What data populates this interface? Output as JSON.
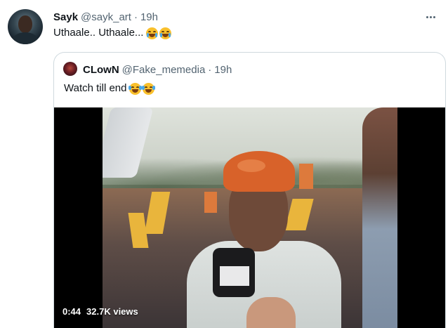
{
  "tweet": {
    "display_name": "Sayk",
    "handle": "@sayk_art",
    "separator": "·",
    "time": "19h",
    "text": "Uthaale.. Uthaale...",
    "emojis": [
      "crying-face",
      "crying-face"
    ]
  },
  "quoted": {
    "display_name": "CLowN",
    "handle": "@Fake_memedia",
    "separator": "·",
    "time": "19h",
    "text": "Watch till end",
    "emojis": [
      "tears-of-joy-face",
      "tears-of-joy-face"
    ],
    "video": {
      "duration": "0:44",
      "views": "32.7K views"
    }
  },
  "icons": {
    "more": "more-horizontal-icon"
  },
  "colors": {
    "text_primary": "#0f1419",
    "text_secondary": "#536471",
    "border": "#cfd9de"
  }
}
